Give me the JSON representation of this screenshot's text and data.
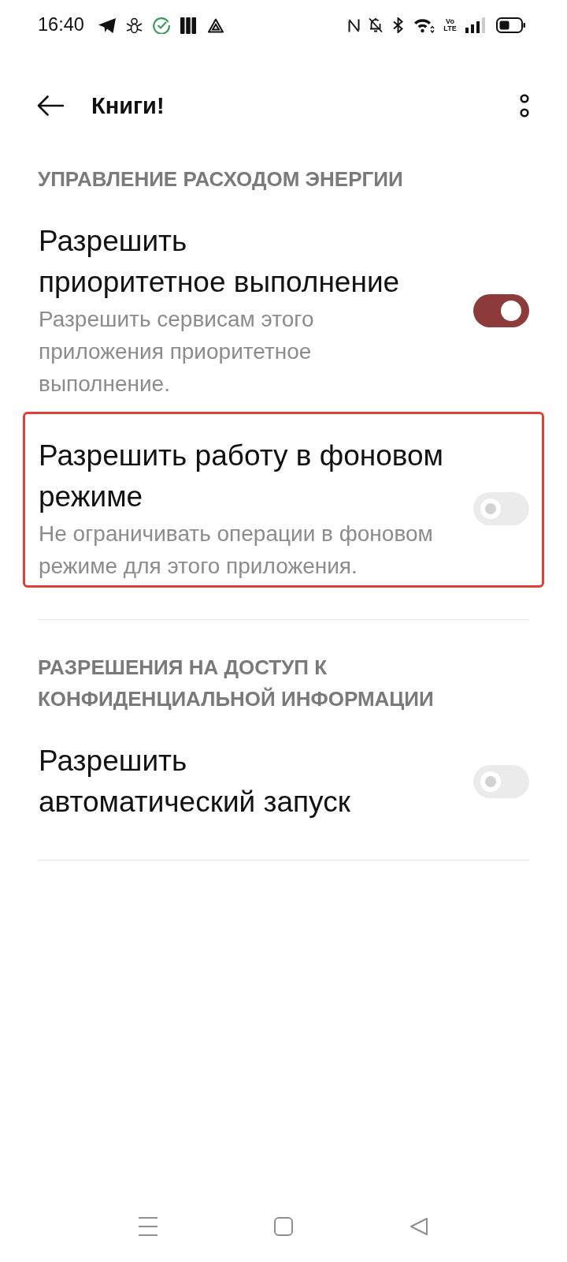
{
  "status_bar": {
    "time": "16:40",
    "network_label": "Vo LTE"
  },
  "header": {
    "title": "Книги!"
  },
  "sections": [
    {
      "title": "УПРАВЛЕНИЕ РАСХОДОМ ЭНЕРГИИ",
      "items": [
        {
          "title": "Разрешить\nприоритетное выполнение",
          "description": "Разрешить сервисам этого\nприложения приоритетное\nвыполнение.",
          "on": true,
          "highlighted": false
        },
        {
          "title": "Разрешить работу в фоновом\nрежиме",
          "description": "Не ограничивать операции в фоновом\nрежиме для этого приложения.",
          "on": false,
          "highlighted": true
        }
      ]
    },
    {
      "title": "РАЗРЕШЕНИЯ НА ДОСТУП К КОНФИДЕНЦИАЛЬНОЙ ИНФОРМАЦИИ",
      "items": [
        {
          "title": "Разрешить\nавтоматический запуск",
          "on": false,
          "highlighted": false
        }
      ]
    }
  ]
}
